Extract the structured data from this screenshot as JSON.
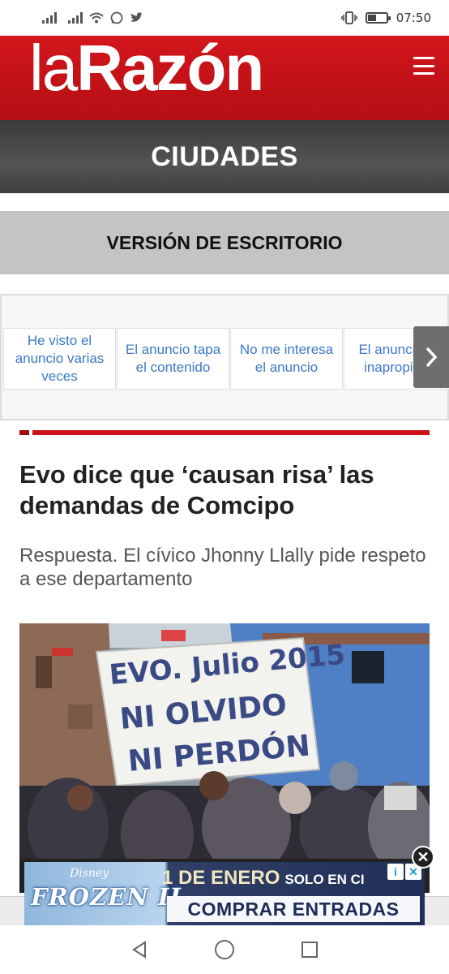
{
  "status_bar": {
    "time": "07:50",
    "left_icons": [
      "signal-icon",
      "signal-icon",
      "wifi-icon",
      "whatsapp-icon",
      "twitter-icon"
    ],
    "right_icons": [
      "vibrate-icon",
      "battery-icon"
    ],
    "battery_level": 0.45
  },
  "header": {
    "logo_part1": "la",
    "logo_part2": "Razón",
    "brand_color": "#d3161c",
    "menu_icon": "hamburger-menu-icon"
  },
  "section": {
    "label": "CIUDADES"
  },
  "desktop_version": {
    "label": "VERSIÓN DE ESCRITORIO"
  },
  "ad_feedback": {
    "options": [
      "He visto el anuncio varias veces",
      "El anuncio tapa el contenido",
      "No me interesa el anuncio",
      "El anuncio es inapropiado"
    ],
    "next_icon": "chevron-right-icon",
    "link_color": "#3b78c7"
  },
  "article": {
    "title": "Evo dice que ‘causan risa’ las demandas de Comcipo",
    "subtitle": "Respuesta. El cívico Jhonny Llally pide respeto a ese departamento",
    "accent_color": "#cc1218",
    "photo_sign": {
      "line1": "EVO. Julio 2015",
      "line2": "NI OLVIDO",
      "line3": "NI PERDÓN"
    }
  },
  "bottom_ad": {
    "brand": "Disney",
    "movie": "FROZEN II",
    "date": "1 DE ENERO",
    "tagline": "SOLO EN CI",
    "cta": "COMPRAR ENTRADAS",
    "close_icon": "close-icon",
    "adchoices_icons": [
      "info-icon",
      "close-x-icon"
    ]
  },
  "nav_bar": {
    "icons": [
      "back-triangle-icon",
      "home-circle-icon",
      "recents-square-icon"
    ]
  }
}
